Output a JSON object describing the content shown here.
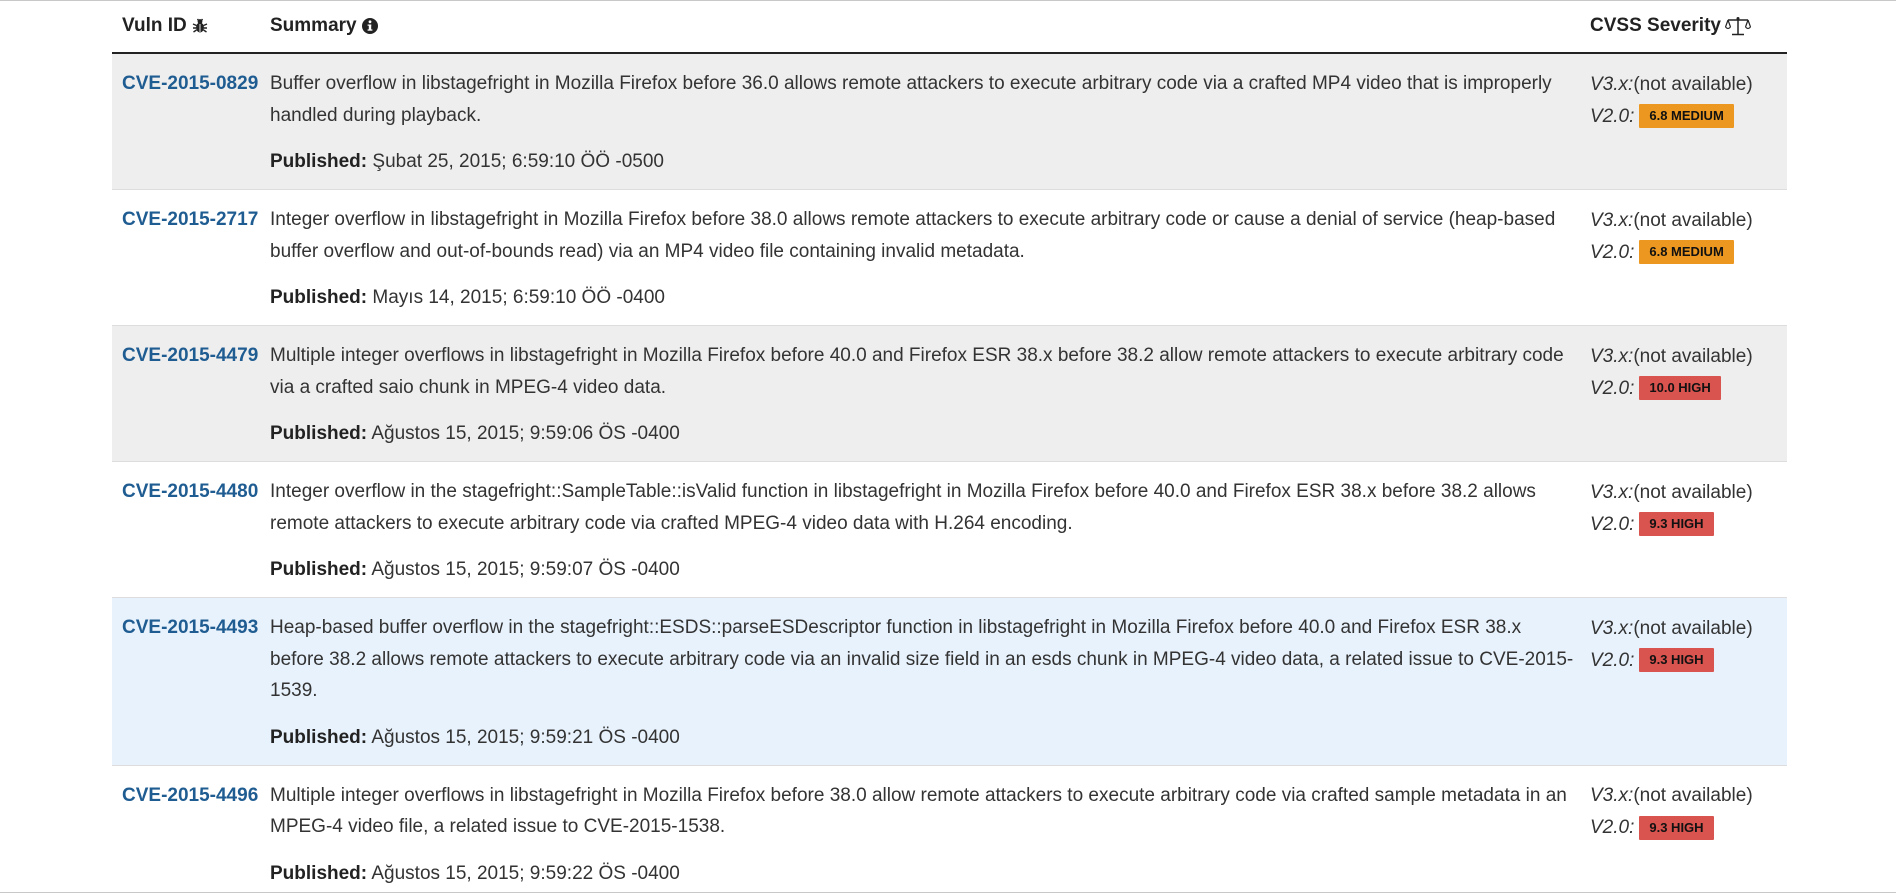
{
  "table": {
    "headers": {
      "vuln_id": "Vuln ID",
      "vuln_id_icon": "bug-icon",
      "summary": "Summary",
      "summary_icon": "info-circle-icon",
      "cvss": "CVSS Severity",
      "cvss_icon": "scale-icon"
    },
    "published_label": "Published:",
    "v3_label": "V3.x:",
    "v2_label": "V2.0:",
    "rows": [
      {
        "id": "CVE-2015-0829",
        "summary": "Buffer overflow in libstagefright in Mozilla Firefox before 36.0 allows remote attackers to execute arbitrary code via a crafted MP4 video that is improperly handled during playback.",
        "published": "Şubat 25, 2015; 6:59:10 ÖÖ -0500",
        "v3": "(not available)",
        "v2": "6.8 MEDIUM",
        "v2_level": "medium"
      },
      {
        "id": "CVE-2015-2717",
        "summary": "Integer overflow in libstagefright in Mozilla Firefox before 38.0 allows remote attackers to execute arbitrary code or cause a denial of service (heap-based buffer overflow and out-of-bounds read) via an MP4 video file containing invalid metadata.",
        "published": "Mayıs 14, 2015; 6:59:10 ÖÖ -0400",
        "v3": "(not available)",
        "v2": "6.8 MEDIUM",
        "v2_level": "medium"
      },
      {
        "id": "CVE-2015-4479",
        "summary": "Multiple integer overflows in libstagefright in Mozilla Firefox before 40.0 and Firefox ESR 38.x before 38.2 allow remote attackers to execute arbitrary code via a crafted saio chunk in MPEG-4 video data.",
        "published": "Ağustos 15, 2015; 9:59:06 ÖS -0400",
        "v3": "(not available)",
        "v2": "10.0 HIGH",
        "v2_level": "high"
      },
      {
        "id": "CVE-2015-4480",
        "summary": "Integer overflow in the stagefright::SampleTable::isValid function in libstagefright in Mozilla Firefox before 40.0 and Firefox ESR 38.x before 38.2 allows remote attackers to execute arbitrary code via crafted MPEG-4 video data with H.264 encoding.",
        "published": "Ağustos 15, 2015; 9:59:07 ÖS -0400",
        "v3": "(not available)",
        "v2": "9.3 HIGH",
        "v2_level": "high"
      },
      {
        "id": "CVE-2015-4493",
        "summary": "Heap-based buffer overflow in the stagefright::ESDS::parseESDescriptor function in libstagefright in Mozilla Firefox before 40.0 and Firefox ESR 38.x before 38.2 allows remote attackers to execute arbitrary code via an invalid size field in an esds chunk in MPEG-4 video data, a related issue to CVE-2015-1539.",
        "published": "Ağustos 15, 2015; 9:59:21 ÖS -0400",
        "v3": "(not available)",
        "v2": "9.3 HIGH",
        "v2_level": "high"
      },
      {
        "id": "CVE-2015-4496",
        "summary": "Multiple integer overflows in libstagefright in Mozilla Firefox before 38.0 allow remote attackers to execute arbitrary code via crafted sample metadata in an MPEG-4 video file, a related issue to CVE-2015-1538.",
        "published": "Ağustos 15, 2015; 9:59:22 ÖS -0400",
        "v3": "(not available)",
        "v2": "9.3 HIGH",
        "v2_level": "high"
      }
    ]
  },
  "colors": {
    "link": "#1f5c91",
    "medium": "#ec971f",
    "high": "#d9534f",
    "row_shade": "#eeeeee",
    "row_hover": "#e8f2fc"
  }
}
